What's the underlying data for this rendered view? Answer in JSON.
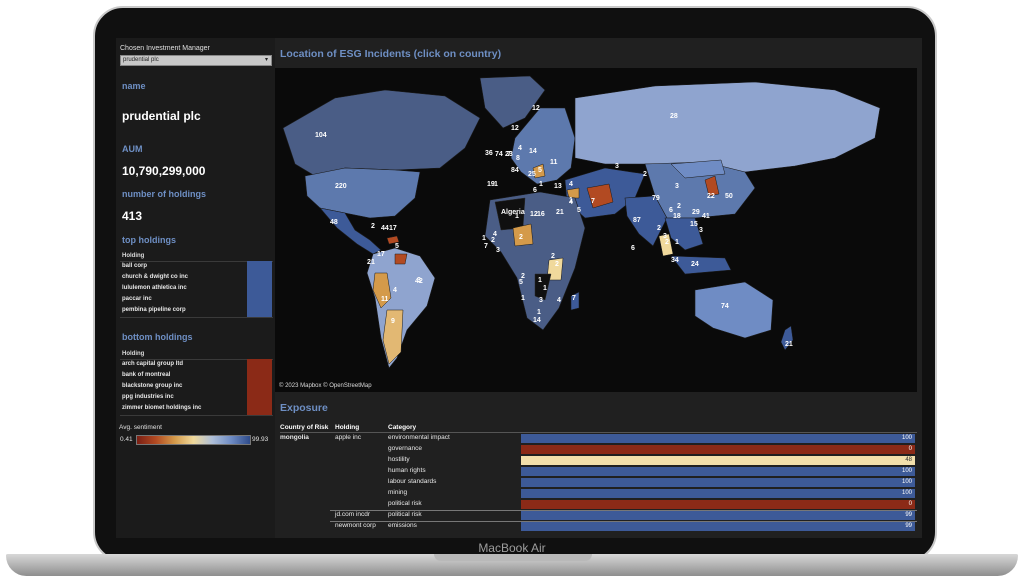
{
  "device": {
    "label": "MacBook Air"
  },
  "filter": {
    "label": "Chosen Investment Manager",
    "value": "prudential plc"
  },
  "manager": {
    "name_label": "name",
    "name_value": "prudential plc",
    "aum_label": "AUM",
    "aum_value": "10,790,299,000",
    "holdings_label": "number of holdings",
    "holdings_value": "413"
  },
  "top_holdings": {
    "title": "top holdings",
    "column": "Holding",
    "bar_color": "#3d5a98",
    "items": [
      "ball corp",
      "church & dwight co inc",
      "lululemon athletica inc",
      "paccar inc",
      "pembina pipeline corp"
    ]
  },
  "bottom_holdings": {
    "title": "bottom holdings",
    "column": "Holding",
    "bar_color": "#8b2a17",
    "items": [
      "arch capital group ltd",
      "bank of montreal",
      "blackstone group inc",
      "ppg industries inc",
      "zimmer biomet holdings inc"
    ]
  },
  "sentiment_legend": {
    "title": "Avg. sentiment",
    "min": "0.41",
    "max": "99.93"
  },
  "map": {
    "title": "Location of ESG Incidents (click on country)",
    "attribution": "© 2023 Mapbox  © OpenStreetMap",
    "country_label": "Algeria",
    "labels": [
      "104",
      "220",
      "48",
      "2",
      "44",
      "17",
      "5",
      "2",
      "17",
      "1",
      "3",
      "42",
      "11",
      "4",
      "9",
      "12",
      "12",
      "4",
      "7",
      "36",
      "74",
      "23",
      "8",
      "14",
      "11",
      "84",
      "25",
      "5",
      "1",
      "6",
      "19",
      "1",
      "13",
      "4",
      "3",
      "2",
      "28",
      "3",
      "2",
      "7",
      "4",
      "1",
      "1",
      "22",
      "50",
      "2",
      "1",
      "7",
      "3",
      "2",
      "4",
      "12",
      "16",
      "21",
      "5",
      "79",
      "87",
      "6",
      "6",
      "18",
      "29",
      "15",
      "41",
      "3",
      "2",
      "3",
      "34",
      "24",
      "2",
      "5",
      "1",
      "1",
      "1",
      "3",
      "4",
      "1",
      "7",
      "2",
      "2",
      "14",
      "74",
      "21",
      "2",
      "1"
    ]
  },
  "exposure": {
    "title": "Exposure",
    "headers": {
      "country": "Country of Risk",
      "holding": "Holding",
      "category": "Category"
    },
    "country": "mongolia",
    "rows": [
      {
        "holding": "apple inc",
        "category": "environmental impact",
        "value": "100",
        "color": "#3d5a98"
      },
      {
        "holding": "",
        "category": "governance",
        "value": "0",
        "color": "#8b2a17"
      },
      {
        "holding": "",
        "category": "hostility",
        "value": "48",
        "color": "#f2dfab"
      },
      {
        "holding": "",
        "category": "human rights",
        "value": "100",
        "color": "#3d5a98"
      },
      {
        "holding": "",
        "category": "labour standards",
        "value": "100",
        "color": "#3d5a98"
      },
      {
        "holding": "",
        "category": "mining",
        "value": "100",
        "color": "#3d5a98"
      },
      {
        "holding": "",
        "category": "political risk",
        "value": "0",
        "color": "#8b2a17"
      },
      {
        "holding": "jd.com incdr",
        "category": "political risk",
        "value": "99",
        "color": "#3d5a98"
      },
      {
        "holding": "newmont corp",
        "category": "emissions",
        "value": "99",
        "color": "#3d5a98"
      }
    ]
  }
}
